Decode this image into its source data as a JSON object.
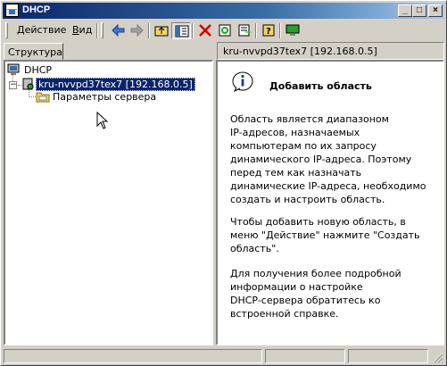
{
  "window": {
    "title": "DHCP"
  },
  "titlebar_buttons": {
    "minimize": "_",
    "maximize": "□",
    "close": "×"
  },
  "menu": {
    "action": {
      "label_ul": "Д",
      "label_rest": "ействие"
    },
    "view": {
      "label_ul": "В",
      "label_rest": "ид"
    }
  },
  "toolbar": {
    "items": [
      "back-icon",
      "forward-icon",
      "up-folder-icon",
      "show-hide-tree-icon",
      "delete-icon",
      "properties-icon",
      "export-list-icon",
      "help-icon",
      "monitor-icon"
    ]
  },
  "left_pane": {
    "tab_label": "Структура"
  },
  "right_pane": {
    "header": "kru-nvvpd37tex7 [192.168.0.5]"
  },
  "tree": {
    "root": "DHCP",
    "server": "kru-nvvpd37tex7 [192.168.0.5]",
    "server_options": "Параметры сервера"
  },
  "info": {
    "title": "Добавить область",
    "para1": "Область является диапазоном\nIP-адресов, назначаемых\nкомпьютерам по их запросу\nдинамического IP-адреса. Поэтому\nперед тем как назначать\nдинамические IP-адреса, необходимо\nсоздать и настроить область.",
    "para2": "Чтобы добавить новую область, в\nменю \"Действие\" нажмите \"Создать\nобласть\".",
    "para3": "Для получения более подробной\nинформации о настройке\nDHCP-сервера обратитесь ко\nвстроенной справке."
  },
  "colors": {
    "selection": "#0a246a",
    "titlebar": "#0a246a",
    "face": "#d4d0c8"
  }
}
